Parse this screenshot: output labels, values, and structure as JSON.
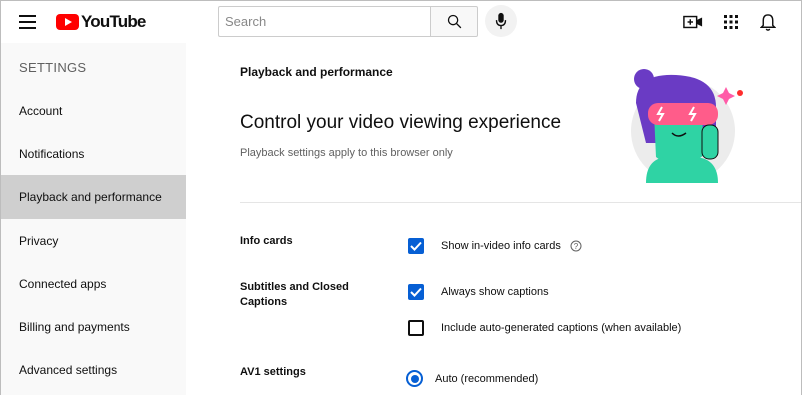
{
  "header": {
    "logo_text": "YouTube",
    "search_placeholder": "Search",
    "brand_color": "#ff0000",
    "icons": [
      "menu-icon",
      "search-icon",
      "mic-icon",
      "create-video-icon",
      "apps-icon",
      "notifications-icon"
    ]
  },
  "sidebar": {
    "title": "SETTINGS",
    "items": [
      {
        "label": "Account",
        "active": false
      },
      {
        "label": "Notifications",
        "active": false
      },
      {
        "label": "Playback and performance",
        "active": true
      },
      {
        "label": "Privacy",
        "active": false
      },
      {
        "label": "Connected apps",
        "active": false
      },
      {
        "label": "Billing and payments",
        "active": false
      },
      {
        "label": "Advanced settings",
        "active": false
      }
    ]
  },
  "main": {
    "section_title": "Playback and performance",
    "headline": "Control your video viewing experience",
    "subhead": "Playback settings apply to this browser only",
    "settings": [
      {
        "label": "Info cards",
        "options": [
          {
            "label": "Show in-video info cards",
            "type": "checkbox",
            "checked": true,
            "help_icon": true
          }
        ]
      },
      {
        "label": "Subtitles and Closed Captions",
        "options": [
          {
            "label": "Always show captions",
            "type": "checkbox",
            "checked": true
          },
          {
            "label": "Include auto-generated captions (when available)",
            "type": "checkbox",
            "checked": false
          }
        ]
      },
      {
        "label": "AV1 settings",
        "options": [
          {
            "label": "Auto (recommended)",
            "type": "radio",
            "checked": true
          }
        ]
      }
    ]
  },
  "colors": {
    "accent": "#065fd4",
    "sidebar_bg": "#f9f9f9",
    "sidebar_active": "#cfcfcf"
  }
}
